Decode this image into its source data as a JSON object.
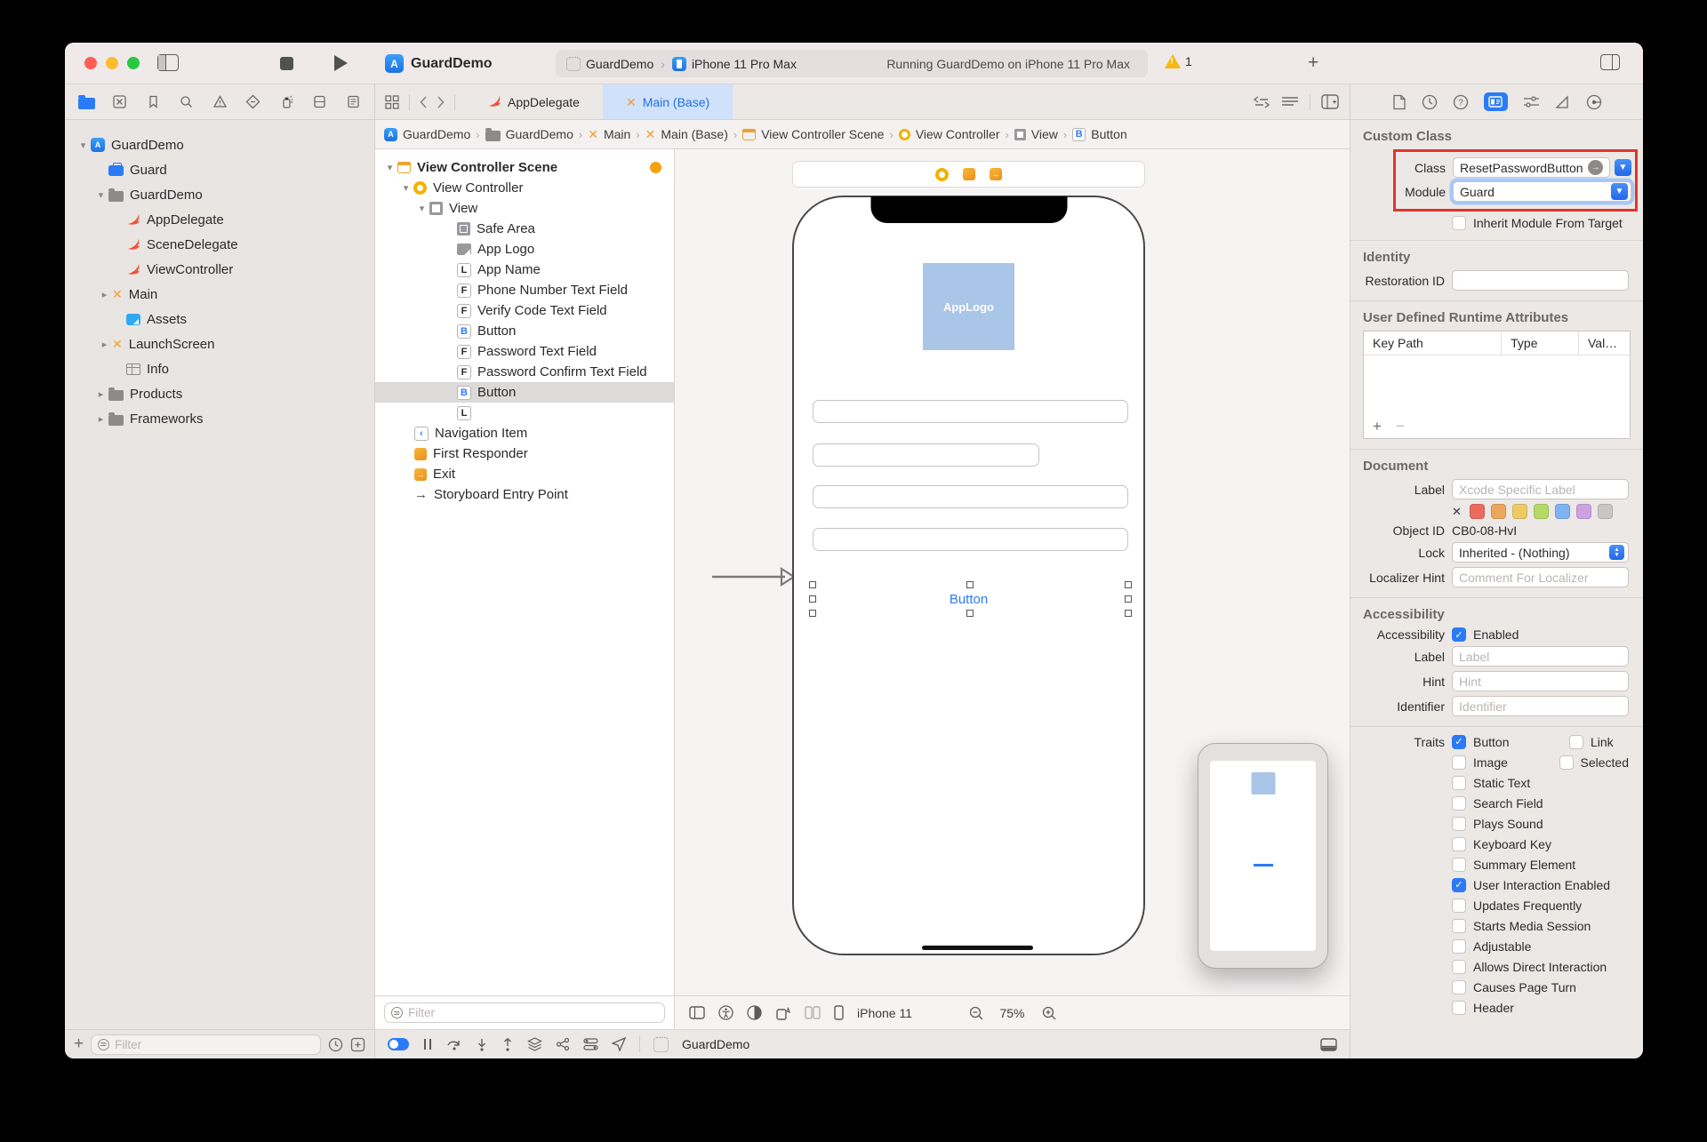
{
  "titlebar": {
    "app_title": "GuardDemo",
    "scheme": "GuardDemo",
    "run_destination": "iPhone 11 Pro Max",
    "status": "Running GuardDemo on iPhone 11 Pro Max",
    "warning_count": "1"
  },
  "editor_tabs": [
    {
      "label": "AppDelegate"
    },
    {
      "label": "Main (Base)",
      "active": true
    }
  ],
  "navigator": {
    "items": [
      {
        "label": "GuardDemo"
      },
      {
        "label": "Guard"
      },
      {
        "label": "GuardDemo"
      },
      {
        "label": "AppDelegate"
      },
      {
        "label": "SceneDelegate"
      },
      {
        "label": "ViewController"
      },
      {
        "label": "Main"
      },
      {
        "label": "Assets"
      },
      {
        "label": "LaunchScreen"
      },
      {
        "label": "Info"
      },
      {
        "label": "Products"
      },
      {
        "label": "Frameworks"
      }
    ],
    "filter_placeholder": "Filter"
  },
  "breadcrumb": [
    "GuardDemo",
    "GuardDemo",
    "Main",
    "Main (Base)",
    "View Controller Scene",
    "View Controller",
    "View",
    "Button"
  ],
  "outline": {
    "items": [
      {
        "label": "View Controller Scene"
      },
      {
        "label": "View Controller"
      },
      {
        "label": "View"
      },
      {
        "label": "Safe Area"
      },
      {
        "label": "App Logo"
      },
      {
        "label": "App Name"
      },
      {
        "label": "Phone Number Text Field"
      },
      {
        "label": "Verify Code Text Field"
      },
      {
        "label": "Button"
      },
      {
        "label": "Password Text Field"
      },
      {
        "label": "Password Confirm Text Field"
      },
      {
        "label": "Button",
        "selected": true
      },
      {
        "label": ""
      },
      {
        "label": "Navigation Item"
      },
      {
        "label": "First Responder"
      },
      {
        "label": "Exit"
      },
      {
        "label": "Storyboard Entry Point"
      }
    ],
    "filter_placeholder": "Filter"
  },
  "canvas": {
    "app_logo": "AppLogo",
    "button_label": "Button",
    "device": "iPhone 11",
    "zoom": "75%"
  },
  "debugbar": {
    "app": "GuardDemo"
  },
  "inspector": {
    "custom_class": {
      "title": "Custom Class",
      "class_label": "Class",
      "class_value": "ResetPasswordButton",
      "module_label": "Module",
      "module_value": "Guard",
      "inherit_label": "Inherit Module From Target"
    },
    "identity": {
      "title": "Identity",
      "restoration_label": "Restoration ID"
    },
    "runtime_attributes": {
      "title": "User Defined Runtime Attributes",
      "columns": [
        "Key Path",
        "Type",
        "Val…"
      ]
    },
    "document": {
      "title": "Document",
      "label_label": "Label",
      "label_placeholder": "Xcode Specific Label",
      "object_id_label": "Object ID",
      "object_id": "CB0-08-HvI",
      "lock_label": "Lock",
      "lock_value": "Inherited - (Nothing)",
      "localizer_label": "Localizer Hint",
      "localizer_placeholder": "Comment For Localizer",
      "swatch_colors": [
        "#e96c5d",
        "#eda75d",
        "#edca62",
        "#b6d867",
        "#7fb2f0",
        "#cda2e2",
        "#c9c6c5"
      ]
    },
    "accessibility": {
      "title": "Accessibility",
      "enabled_label": "Accessibility",
      "enabled_value": "Enabled",
      "label_label": "Label",
      "label_placeholder": "Label",
      "hint_label": "Hint",
      "hint_placeholder": "Hint",
      "identifier_label": "Identifier",
      "identifier_placeholder": "Identifier",
      "traits_label": "Traits",
      "traits": [
        {
          "label": "Button",
          "checked": true
        },
        {
          "label": "Link",
          "checked": false
        },
        {
          "label": "Image",
          "checked": false
        },
        {
          "label": "Selected",
          "checked": false
        },
        {
          "label": "Static Text",
          "checked": false
        },
        {
          "label": "Search Field",
          "checked": false
        },
        {
          "label": "Plays Sound",
          "checked": false
        },
        {
          "label": "Keyboard Key",
          "checked": false
        },
        {
          "label": "Summary Element",
          "checked": false
        },
        {
          "label": "User Interaction Enabled",
          "checked": true
        },
        {
          "label": "Updates Frequently",
          "checked": false
        },
        {
          "label": "Starts Media Session",
          "checked": false
        },
        {
          "label": "Adjustable",
          "checked": false
        },
        {
          "label": "Allows Direct Interaction",
          "checked": false
        },
        {
          "label": "Causes Page Turn",
          "checked": false
        },
        {
          "label": "Header",
          "checked": false
        }
      ]
    }
  },
  "colors": {
    "accent_blue": "#2c7bf6",
    "ib_orange": "#f0a030",
    "swift_orange": "#ef5138",
    "annotation_red": "#e0352b",
    "active_tab_bg": "#d0e2fb",
    "applogo_blue": "#a9c5e8"
  }
}
